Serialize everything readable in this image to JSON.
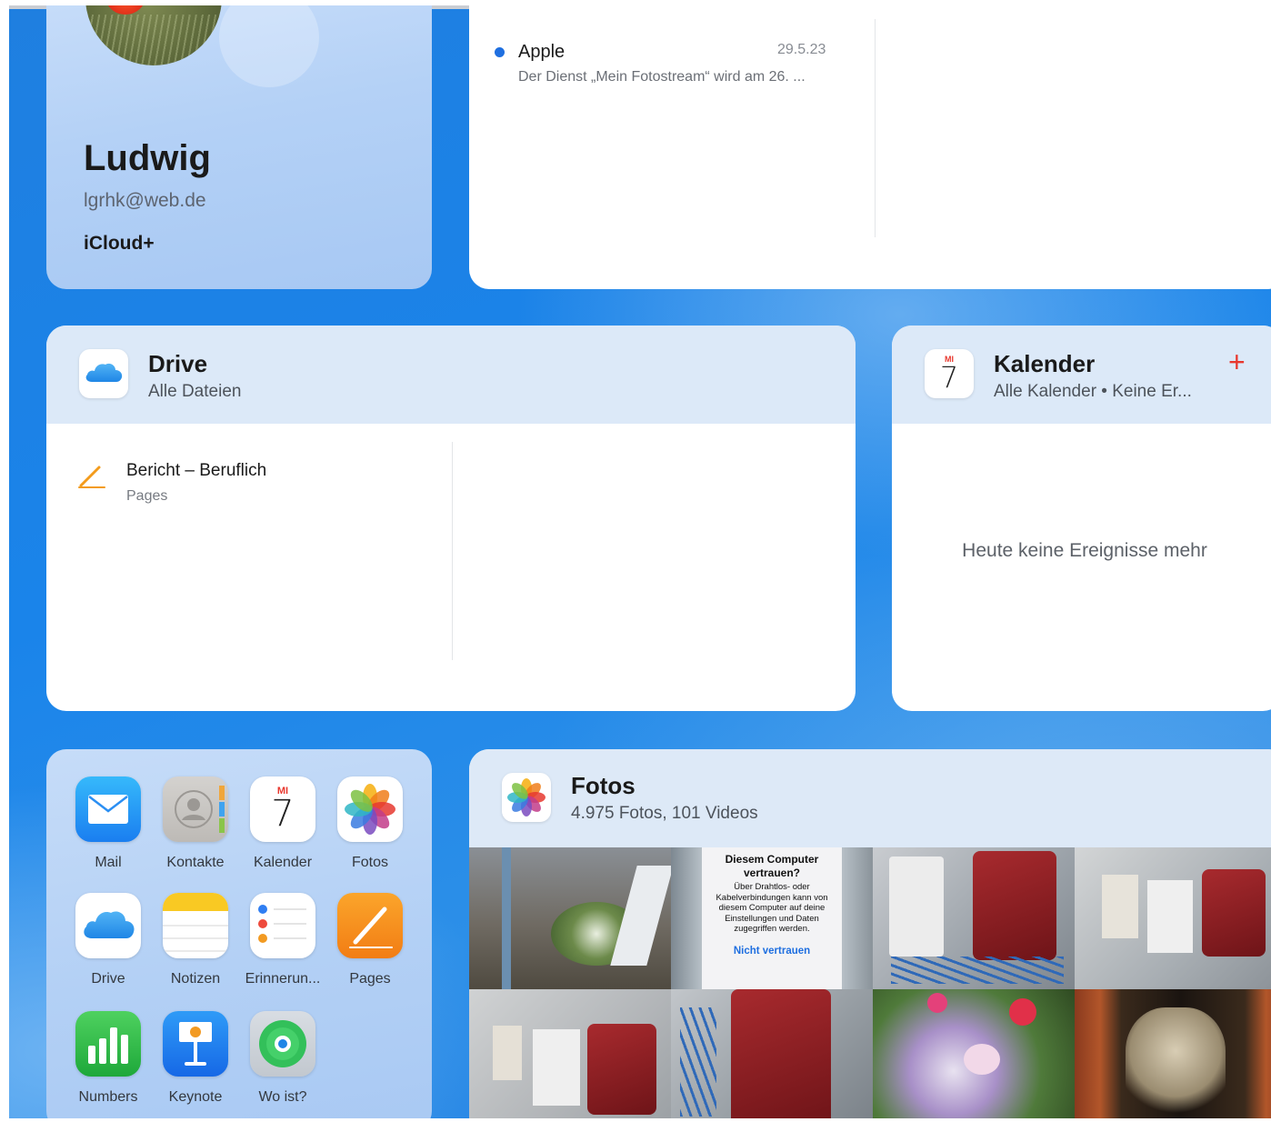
{
  "profile": {
    "name": "Ludwig",
    "email": "lgrhk@web.de",
    "plan": "iCloud+"
  },
  "mail": {
    "items": [
      {
        "from": "Apple",
        "date": "29.5.23",
        "preview": "Der Dienst „Mein Fotostream“ wird am 26. ...",
        "unread": true
      }
    ]
  },
  "drive": {
    "title": "Drive",
    "subtitle": "Alle Dateien",
    "files": [
      {
        "name": "Bericht – Beruflich",
        "type": "Pages"
      }
    ]
  },
  "calendar": {
    "title": "Kalender",
    "subtitle": "Alle Kalender • Keine Er...",
    "add_icon": "+",
    "icon_weekday": "MI",
    "icon_day": "7",
    "empty_message": "Heute keine Ereignisse mehr"
  },
  "apps": [
    {
      "label": "Mail",
      "icon": "mail-icon"
    },
    {
      "label": "Kontakte",
      "icon": "contacts-icon"
    },
    {
      "label": "Kalender",
      "icon": "calendar-icon"
    },
    {
      "label": "Fotos",
      "icon": "photos-icon"
    },
    {
      "label": "Drive",
      "icon": "drive-icon"
    },
    {
      "label": "Notizen",
      "icon": "notes-icon"
    },
    {
      "label": "Erinnerun...",
      "icon": "reminders-icon"
    },
    {
      "label": "Pages",
      "icon": "pages-icon"
    },
    {
      "label": "Numbers",
      "icon": "numbers-icon"
    },
    {
      "label": "Keynote",
      "icon": "keynote-icon"
    },
    {
      "label": "Wo ist?",
      "icon": "find-my-icon"
    }
  ],
  "photos": {
    "title": "Fotos",
    "subtitle": "4.975 Fotos, 101 Videos",
    "dialog": {
      "title": "Diesem Computer vertrauen?",
      "body": "Über Drahtlos- oder Kabelverbindungen kann von diesem Computer auf deine Einstellungen und Daten zugegriffen werden.",
      "button": "Nicht vertrauen"
    }
  },
  "colors": {
    "accent": "#1f6fe0",
    "calendar_red": "#e8372d",
    "background_blue": "#1a84ea"
  }
}
